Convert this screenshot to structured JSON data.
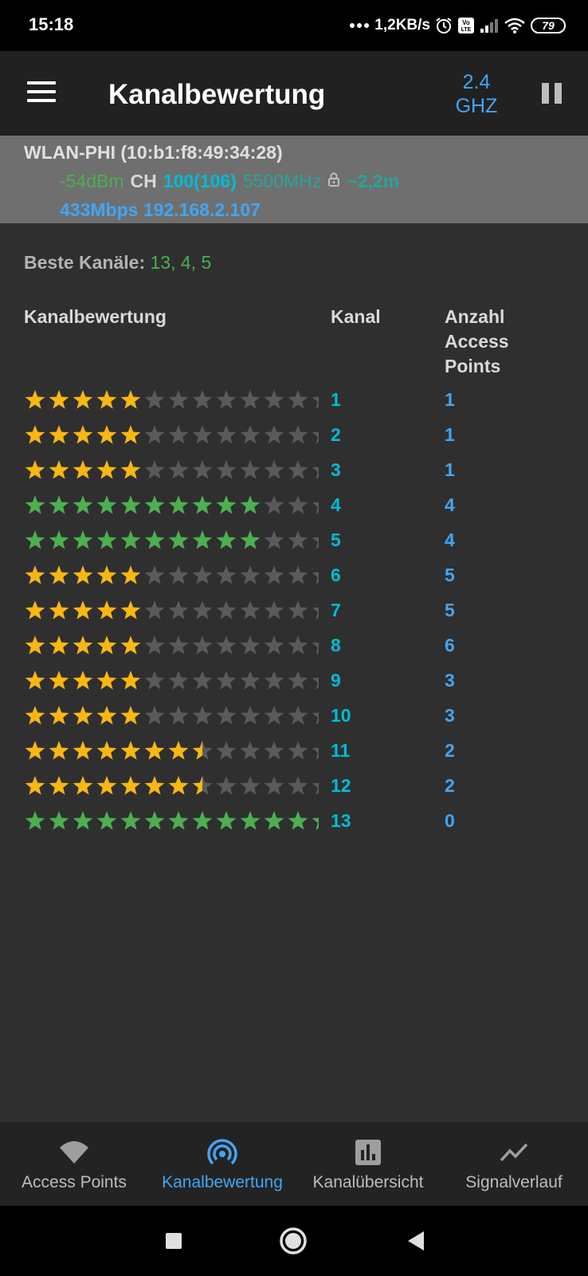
{
  "status_bar": {
    "time": "15:18",
    "network_speed": "1,2KB/s",
    "battery": "79",
    "icons": [
      "dots-icon",
      "alarm-icon",
      "volte-icon",
      "signal-icon",
      "wifi-icon",
      "battery-icon"
    ]
  },
  "app_bar": {
    "title": "Kanalbewertung",
    "band_line1": "2.4",
    "band_line2": "GHZ",
    "menu_icon": "menu-icon",
    "pause_icon": "pause-icon"
  },
  "connection": {
    "ssid": "WLAN-PHI (10:b1:f8:49:34:28)",
    "signal": "-54dBm",
    "ch_label": "CH",
    "channel": "100(106)",
    "frequency": "5500MHz",
    "distance": "~2,2m",
    "speed": "433Mbps",
    "ip": "192.168.2.107"
  },
  "best_channels": {
    "label": "Beste Kanäle:",
    "value": "13, 4, 5"
  },
  "table": {
    "headers": {
      "rating": "Kanalbewertung",
      "channel": "Kanal",
      "count": "Anzahl Access Points"
    },
    "rows": [
      {
        "channel": "1",
        "count": "1",
        "rating": 5.0,
        "color": "#f9b714"
      },
      {
        "channel": "2",
        "count": "1",
        "rating": 5.0,
        "color": "#f9b714"
      },
      {
        "channel": "3",
        "count": "1",
        "rating": 5.0,
        "color": "#f9b714"
      },
      {
        "channel": "4",
        "count": "4",
        "rating": 10.0,
        "color": "#4caf50"
      },
      {
        "channel": "5",
        "count": "4",
        "rating": 10.0,
        "color": "#4caf50"
      },
      {
        "channel": "6",
        "count": "5",
        "rating": 5.0,
        "color": "#f9b714"
      },
      {
        "channel": "7",
        "count": "5",
        "rating": 5.0,
        "color": "#f9b714"
      },
      {
        "channel": "8",
        "count": "6",
        "rating": 5.0,
        "color": "#f9b714"
      },
      {
        "channel": "9",
        "count": "3",
        "rating": 5.0,
        "color": "#f9b714"
      },
      {
        "channel": "10",
        "count": "3",
        "rating": 5.0,
        "color": "#f9b714"
      },
      {
        "channel": "11",
        "count": "2",
        "rating": 7.5,
        "color": "#f9b714"
      },
      {
        "channel": "12",
        "count": "2",
        "rating": 7.5,
        "color": "#f9b714"
      },
      {
        "channel": "13",
        "count": "0",
        "rating": 12.5,
        "color": "#4caf50"
      }
    ],
    "empty_star_color": "#5a5a5a"
  },
  "bottom_nav": {
    "items": [
      {
        "label": "Access Points",
        "icon": "wifi-icon",
        "active": false
      },
      {
        "label": "Kanalbewertung",
        "icon": "radar-icon",
        "active": true
      },
      {
        "label": "Kanalübersicht",
        "icon": "bar-chart-icon",
        "active": false
      },
      {
        "label": "Signalverlauf",
        "icon": "line-chart-icon",
        "active": false
      }
    ],
    "active_color": "#42a5f5",
    "inactive_color": "#bdbdbd"
  },
  "system_nav": {
    "icons": [
      "recents-icon",
      "home-icon",
      "back-icon"
    ]
  }
}
